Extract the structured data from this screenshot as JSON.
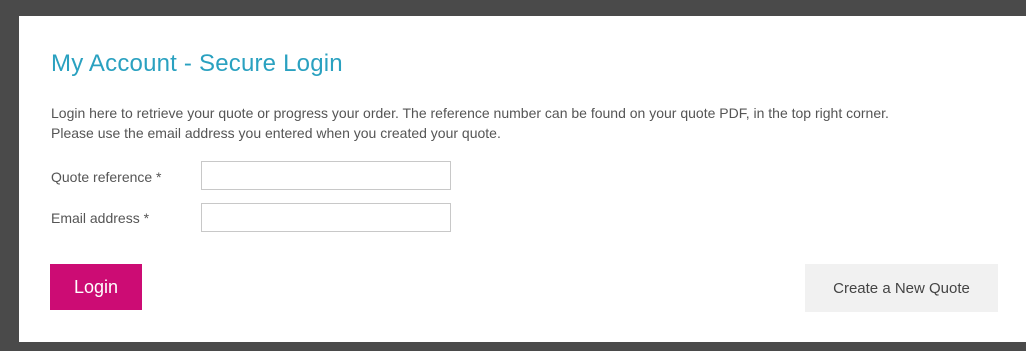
{
  "login_panel": {
    "title": "My Account - Secure Login",
    "intro_line_1": "Login here to retrieve your quote or progress your order. The reference number can be found on your quote PDF, in the top right corner.",
    "intro_line_2": "Please use the email address you entered when you created your quote.",
    "quote_reference": {
      "label": "Quote reference *",
      "value": ""
    },
    "email_address": {
      "label": "Email address *",
      "value": ""
    },
    "login_button_label": "Login",
    "new_quote_button_label": "Create a New Quote"
  },
  "colors": {
    "title": "#2aa1c0",
    "login_button": "#cc0c74",
    "new_quote_button": "#f1f1f1",
    "frame": "#4a4a4a"
  }
}
